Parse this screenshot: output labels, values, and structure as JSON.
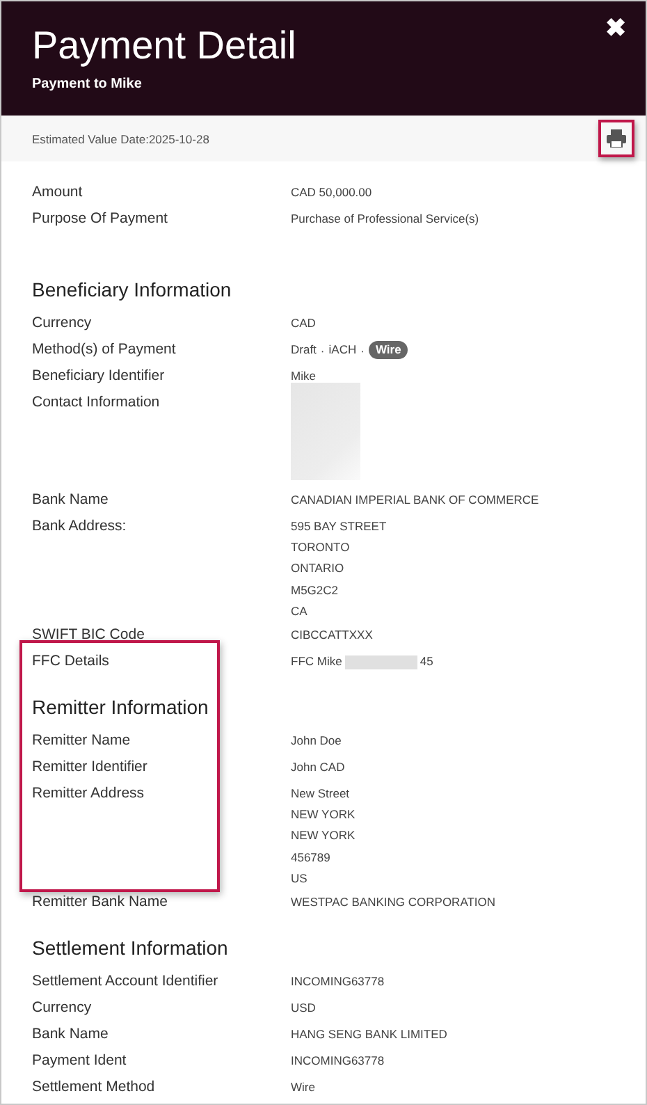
{
  "header": {
    "title": "Payment Detail",
    "subtitle": "Payment to Mike",
    "close_icon": "✖"
  },
  "subheader": {
    "estimated_value_date": "Estimated Value Date:2025-10-28",
    "print_highlighted": true
  },
  "sections": [
    {
      "rows": [
        {
          "label": "Amount",
          "value": "CAD 50,000.00",
          "highlighted": false
        },
        {
          "label": "Purpose Of Payment",
          "value": "Purchase of Professional Service(s)",
          "highlighted": false
        }
      ]
    },
    {
      "heading": "Beneficiary Information",
      "heading_highlighted": false,
      "rows": [
        {
          "label": "Currency",
          "value": "CAD",
          "highlighted": false
        },
        {
          "label": "Method(s) of Payment",
          "kind": "methods",
          "separator": "·",
          "options": [
            {
              "label": "Draft",
              "selected": false
            },
            {
              "label": "iACH",
              "selected": false
            },
            {
              "label": "Wire",
              "selected": true
            }
          ],
          "highlighted": false
        },
        {
          "label": "Beneficiary Identifier",
          "value": "Mike",
          "highlighted": false
        },
        {
          "label": "Contact Information",
          "kind": "redacted",
          "highlighted": false
        },
        {
          "label": "Bank Name",
          "value": "CANADIAN IMPERIAL BANK OF COMMERCE",
          "highlighted": false
        },
        {
          "label": "Bank Address:",
          "kind": "lines",
          "lines": [
            "595 BAY STREET",
            "TORONTO",
            "ONTARIO",
            "M5G2C2",
            "CA"
          ],
          "highlighted": false
        },
        {
          "label": "SWIFT BIC Code",
          "value": "CIBCCATTXXX",
          "highlighted": false
        },
        {
          "label": "FFC Details",
          "kind": "masked",
          "value": "FFC Mike",
          "suffix": "45",
          "highlighted": true
        }
      ]
    },
    {
      "heading": "Remitter Information",
      "heading_highlighted": true,
      "rows": [
        {
          "label": "Remitter Name",
          "value": "John Doe",
          "highlighted": true
        },
        {
          "label": "Remitter Identifier",
          "value": "John CAD",
          "highlighted": true
        },
        {
          "label": "Remitter Address",
          "kind": "lines",
          "lines": [
            "New Street",
            "NEW YORK",
            "NEW YORK",
            "456789",
            "US"
          ],
          "highlighted": true
        },
        {
          "label": "Remitter Bank Name",
          "value": "WESTPAC BANKING CORPORATION",
          "highlighted": false
        }
      ]
    },
    {
      "heading": "Settlement Information",
      "heading_highlighted": false,
      "rows": [
        {
          "label": "Settlement Account Identifier",
          "value": "INCOMING63778",
          "highlighted": false
        },
        {
          "label": "Currency",
          "value": "USD",
          "highlighted": false
        },
        {
          "label": "Bank Name",
          "value": "HANG SENG BANK LIMITED",
          "highlighted": false
        },
        {
          "label": "Payment Ident",
          "value": "INCOMING63778",
          "highlighted": false
        },
        {
          "label": "Settlement Method",
          "value": "Wire",
          "highlighted": false
        }
      ]
    }
  ]
}
